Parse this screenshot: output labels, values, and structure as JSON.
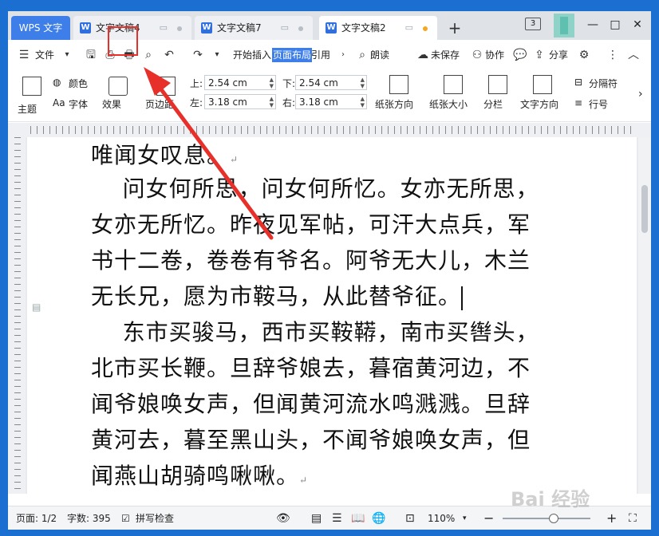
{
  "tabs": {
    "app": "WPS 文字",
    "docs": [
      {
        "title": "文字文稿4"
      },
      {
        "title": "文字文稿7"
      },
      {
        "title": "文字文稿2"
      }
    ],
    "add": "+"
  },
  "window_controls": {
    "badge": "3",
    "minimize": "—",
    "restore": "□",
    "close": "✕"
  },
  "menu": {
    "file": "文件",
    "start": "开始",
    "insert": "插入",
    "page_layout": "页面布局",
    "reference": "引用",
    "read_aloud": "朗读",
    "unsaved": "未保存",
    "collaborate": "协作",
    "share": "分享"
  },
  "ribbon": {
    "theme": "主题",
    "color": "颜色",
    "font": "字体",
    "effect": "效果",
    "margin": "页边距",
    "top_label": "上:",
    "top_value": "2.54 cm",
    "bottom_label": "下:",
    "bottom_value": "2.54 cm",
    "left_label": "左:",
    "left_value": "3.18 cm",
    "right_label": "右:",
    "right_value": "3.18 cm",
    "orientation": "纸张方向",
    "paper_size": "纸张大小",
    "columns": "分栏",
    "text_direction": "文字方向",
    "separator": "分隔符",
    "line_number": "行号"
  },
  "document": {
    "lines": [
      "唯闻女叹息。",
      "    问女何所思，问女何所忆。女亦无所思，",
      "女亦无所忆。昨夜见军帖，可汗大点兵，军",
      "书十二卷，卷卷有爷名。阿爷无大儿，木兰",
      "无长兄，愿为市鞍马，从此替爷征。",
      "    东市买骏马，西市买鞍鞯，南市买辔头，",
      "北市买长鞭。旦辞爷娘去，暮宿黄河边，不",
      "闻爷娘唤女声，但闻黄河流水鸣溅溅。旦辞",
      "黄河去，暮至黑山头，不闻爷娘唤女声，但",
      "闻燕山胡骑鸣啾啾。"
    ]
  },
  "status": {
    "page": "页面: 1/2",
    "words": "字数: 395",
    "spellcheck": "拼写检查",
    "zoom": "110%"
  },
  "watermark": "Bai 经验",
  "colors": {
    "accent": "#3e7ee8",
    "annotation": "#e8302a",
    "desktop": "#1a6fd1"
  }
}
